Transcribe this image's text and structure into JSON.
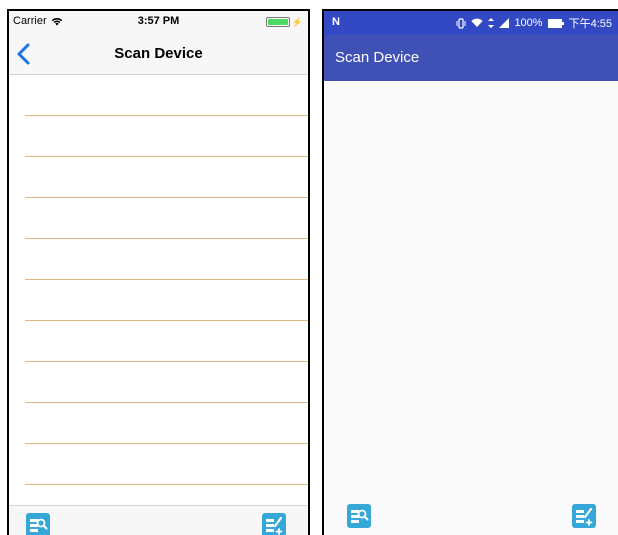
{
  "ios": {
    "status": {
      "carrier": "Carrier",
      "time": "3:57 PM"
    },
    "nav": {
      "title": "Scan Device"
    },
    "list_rows": 10,
    "toolbar": {
      "left_icon": "scan-device-icon",
      "right_icon": "add-device-icon"
    }
  },
  "android": {
    "status": {
      "notification": "N",
      "battery": "100%",
      "time": "下午4:55"
    },
    "app_bar": {
      "title": "Scan Device"
    },
    "actions": {
      "left_icon": "scan-device-icon",
      "right_icon": "add-device-icon"
    }
  },
  "colors": {
    "android_primary": "#3f51b5",
    "android_status": "#3349c4",
    "ios_accent": "#1a73e8",
    "separator": "#e2b585",
    "action_button": "#36a7d9"
  }
}
